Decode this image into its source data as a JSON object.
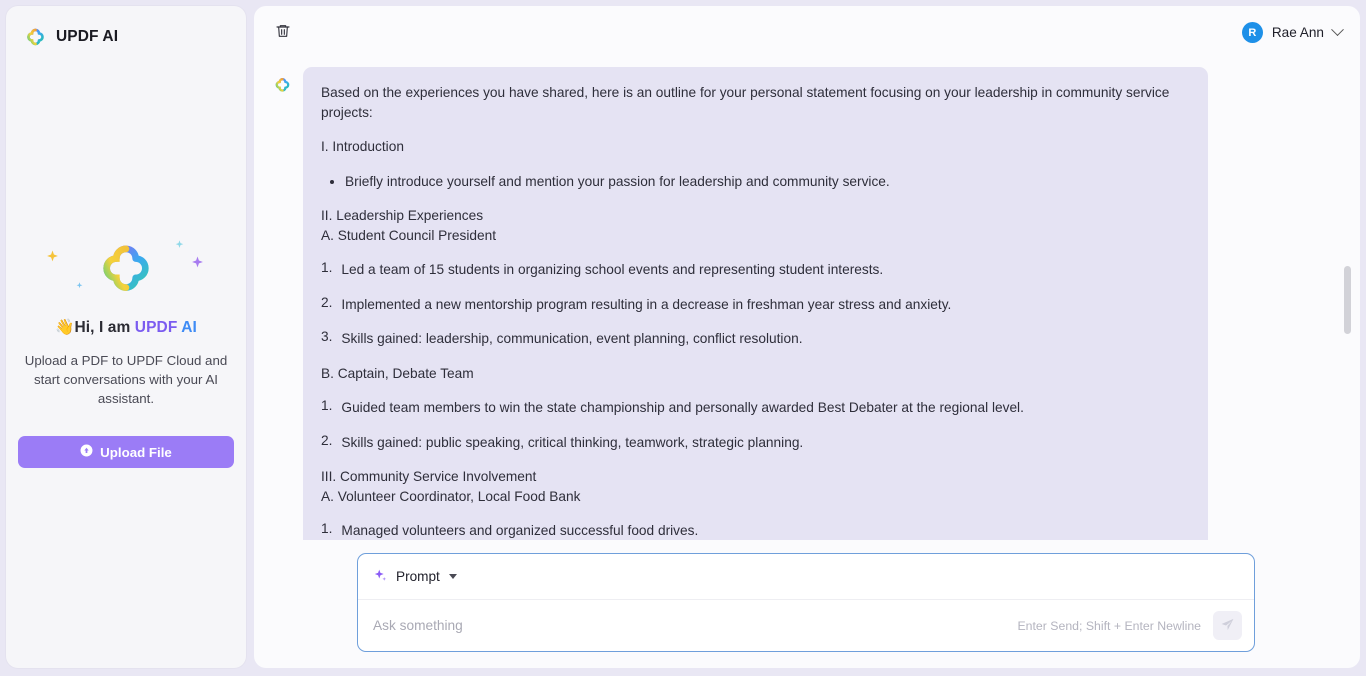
{
  "sidebar": {
    "brand_label": "UPDF AI",
    "brand_icon": "clover-logo-icon",
    "hero_icon": "clover-logo-large-icon",
    "greeting_emoji": "👋",
    "greeting_prefix": "Hi, I am ",
    "greeting_brand_1": "UPDF",
    "greeting_brand_2": "AI",
    "description": "Upload a PDF to UPDF Cloud and start conversations with your AI assistant.",
    "upload_button_label": "Upload File",
    "upload_icon": "upload-circle-icon"
  },
  "header": {
    "delete_icon": "trash-icon",
    "avatar_initial": "R",
    "user_name": "Rae Ann",
    "chevron_icon": "chevron-down-icon"
  },
  "chat": {
    "assistant_icon": "clover-avatar-icon",
    "message": {
      "intro": "Based on the experiences you have shared, here is an outline for your personal statement focusing on your leadership in community service projects:",
      "section_1_heading": "I. Introduction",
      "section_1_bullets": [
        "Briefly introduce yourself and mention your passion for leadership and community service."
      ],
      "section_2_heading": "II. Leadership Experiences\nA. Student Council President",
      "section_2_items": [
        {
          "n": "1.",
          "t": "Led a team of 15 students in organizing school events and representing student interests."
        },
        {
          "n": "2.",
          "t": "Implemented a new mentorship program resulting in a decrease in freshman year stress and anxiety."
        },
        {
          "n": "3.",
          "t": "Skills gained: leadership, communication, event planning, conflict resolution."
        }
      ],
      "section_3_heading": "B. Captain, Debate Team",
      "section_3_items": [
        {
          "n": "1.",
          "t": "Guided team members to win the state championship and personally awarded Best Debater at the regional level."
        },
        {
          "n": "2.",
          "t": "Skills gained: public speaking, critical thinking, teamwork, strategic planning."
        }
      ],
      "section_4_heading": "III. Community Service Involvement\nA. Volunteer Coordinator, Local Food Bank",
      "section_4_items": [
        {
          "n": "1.",
          "t": "Managed volunteers and organized successful food drives."
        }
      ]
    }
  },
  "composer": {
    "prompt_label": "Prompt",
    "prompt_icon": "sparkle-icon",
    "caret_icon": "caret-down-icon",
    "input_value": "",
    "input_placeholder": "Ask something",
    "hint": "Enter Send; Shift + Enter Newline",
    "send_icon": "send-plane-icon"
  },
  "colors": {
    "accent_purple": "#9b7cf6",
    "brand_purple": "#7b5cf0",
    "brand_blue": "#3e8bf5",
    "bubble_bg": "#e5e3f3",
    "composer_border": "#6f9fdb",
    "avatar_blue": "#1e90e8",
    "app_bg": "#e9e7f4"
  }
}
